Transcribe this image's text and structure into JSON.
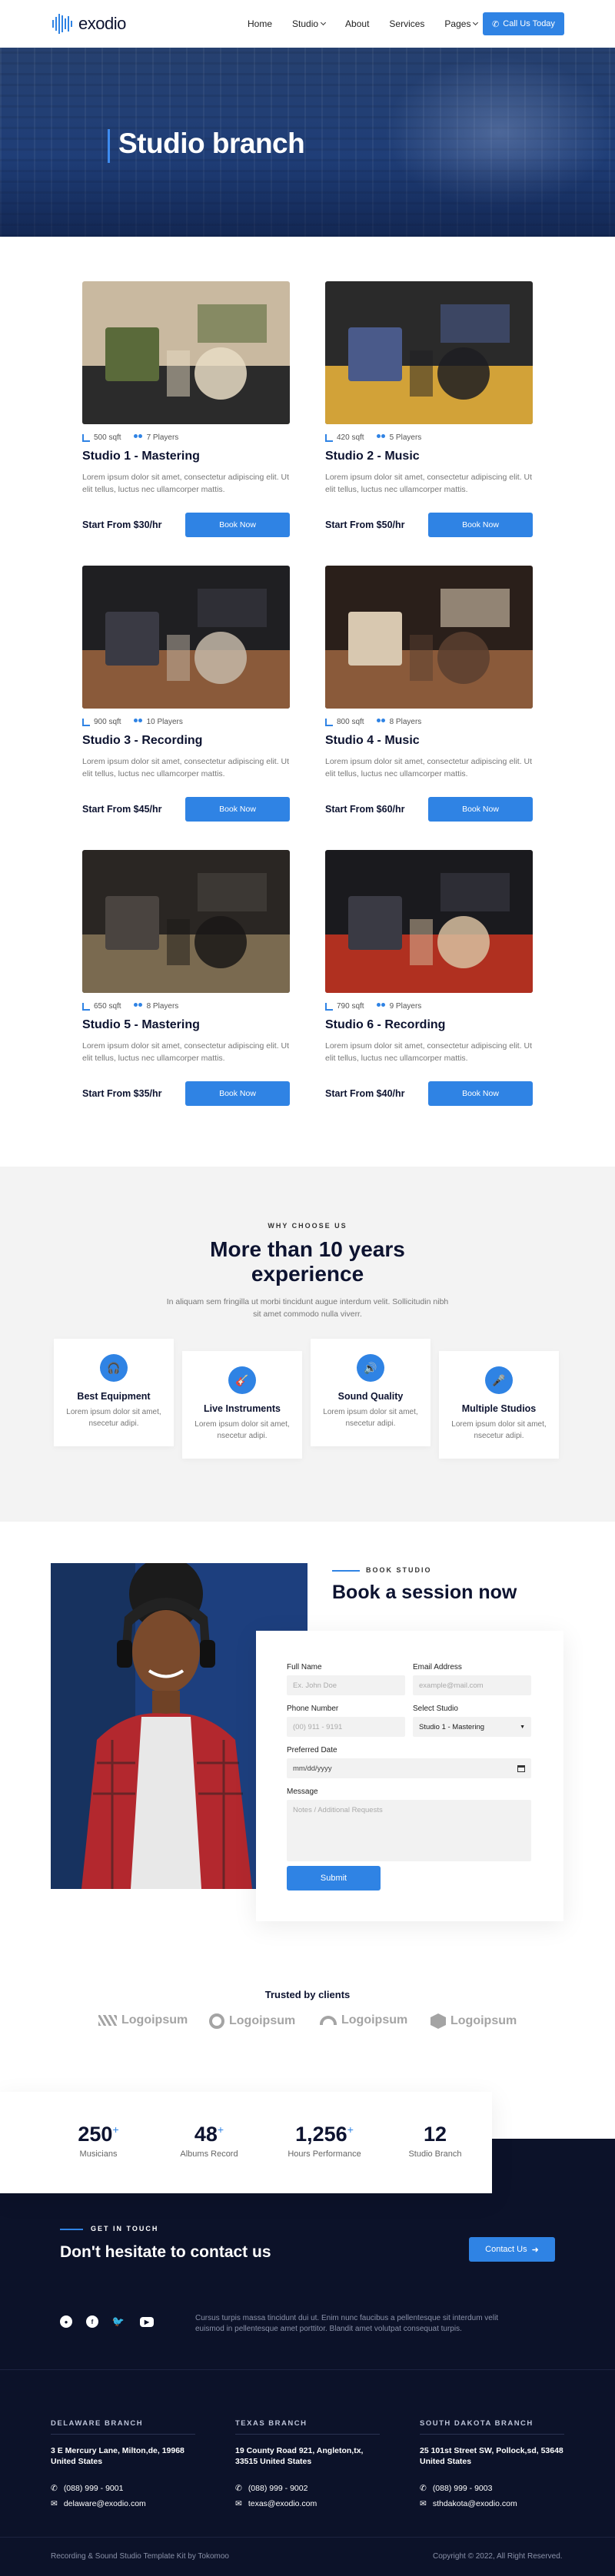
{
  "header": {
    "logo_text": "exodio",
    "nav": [
      "Home",
      "Studio",
      "About",
      "Services",
      "Pages"
    ],
    "call_label": "Call Us Today"
  },
  "hero": {
    "title": "Studio branch"
  },
  "studios": [
    {
      "size": "500 sqft",
      "players": "7 Players",
      "title": "Studio 1 - Mastering",
      "desc": "Lorem ipsum dolor sit amet, consectetur adipiscing elit. Ut elit tellus, luctus nec ullamcorper mattis.",
      "price": "Start From $30/hr",
      "cta": "Book Now"
    },
    {
      "size": "420 sqft",
      "players": "5 Players",
      "title": "Studio 2 - Music",
      "desc": "Lorem ipsum dolor sit amet, consectetur adipiscing elit. Ut elit tellus, luctus nec ullamcorper mattis.",
      "price": "Start From $50/hr",
      "cta": "Book Now"
    },
    {
      "size": "900 sqft",
      "players": "10 Players",
      "title": "Studio 3 - Recording",
      "desc": "Lorem ipsum dolor sit amet, consectetur adipiscing elit. Ut elit tellus, luctus nec ullamcorper mattis.",
      "price": "Start From $45/hr",
      "cta": "Book Now"
    },
    {
      "size": "800 sqft",
      "players": "8 Players",
      "title": "Studio 4 - Music",
      "desc": "Lorem ipsum dolor sit amet, consectetur adipiscing elit. Ut elit tellus, luctus nec ullamcorper mattis.",
      "price": "Start From $60/hr",
      "cta": "Book Now"
    },
    {
      "size": "650 sqft",
      "players": "8 Players",
      "title": "Studio 5 - Mastering",
      "desc": "Lorem ipsum dolor sit amet, consectetur adipiscing elit. Ut elit tellus, luctus nec ullamcorper mattis.",
      "price": "Start From $35/hr",
      "cta": "Book Now"
    },
    {
      "size": "790 sqft",
      "players": "9 Players",
      "title": "Studio 6 - Recording",
      "desc": "Lorem ipsum dolor sit amet, consectetur adipiscing elit. Ut elit tellus, luctus nec ullamcorper mattis.",
      "price": "Start From $40/hr",
      "cta": "Book Now"
    }
  ],
  "why": {
    "eyebrow": "WHY CHOOSE US",
    "title_line1": "More than 10 years",
    "title_line2": "experience",
    "desc_line1": "In aliquam sem fringilla ut morbi tincidunt augue interdum velit. Sollicitudin nibh",
    "desc_line2": "sit amet commodo nulla viverr.",
    "features": [
      {
        "title": "Best Equipment",
        "desc": "Lorem ipsum dolor sit amet, nsecetur adipi."
      },
      {
        "title": "Live Instruments",
        "desc": "Lorem ipsum dolor sit amet, nsecetur adipi."
      },
      {
        "title": "Sound Quality",
        "desc": "Lorem ipsum dolor sit amet, nsecetur adipi."
      },
      {
        "title": "Multiple Studios",
        "desc": "Lorem ipsum dolor sit amet, nsecetur adipi."
      }
    ]
  },
  "booking": {
    "eyebrow": "BOOK STUDIO",
    "title": "Book a session now",
    "full_name_label": "Full Name",
    "full_name_placeholder": "Ex. John Doe",
    "email_label": "Email Address",
    "email_placeholder": "example@mail.com",
    "phone_label": "Phone Number",
    "phone_placeholder": "(00) 911 - 9191",
    "select_label": "Select Studio",
    "select_value": "Studio 1 - Mastering",
    "date_label": "Preferred Date",
    "date_placeholder": "mm/dd/yyyy",
    "message_label": "Message",
    "message_placeholder": "Notes / Additional Requests",
    "submit": "Submit"
  },
  "clients": {
    "title": "Trusted by clients",
    "logos": [
      "Logoipsum",
      "Logoipsum",
      "Logoipsum",
      "Logoipsum"
    ]
  },
  "stats": [
    {
      "num": "250",
      "plus": "+",
      "label": "Musicians"
    },
    {
      "num": "48",
      "plus": "+",
      "label": "Albums Record"
    },
    {
      "num": "1,256",
      "plus": "+",
      "label": "Hours Performance"
    },
    {
      "num": "12",
      "plus": "",
      "label": "Studio Branch"
    }
  ],
  "contact": {
    "eyebrow": "GET IN TOUCH",
    "title": "Don't hesitate to contact us",
    "button": "Contact Us",
    "about_line1": "Cursus turpis massa tincidunt dui ut. Enim nunc faucibus a pellentesque sit interdum velit",
    "about_line2": "euismod in pellentesque  amet porttitor. Blandit amet volutpat consequat turpis."
  },
  "branches": [
    {
      "name": "DELAWARE BRANCH",
      "addr1": "3 E Mercury Lane, Milton,de, 19968",
      "addr2": "United States",
      "phone": "(088) 999 - 9001",
      "email": "delaware@exodio.com"
    },
    {
      "name": "TEXAS BRANCH",
      "addr1": "19 County Road 921, Angleton,tx,",
      "addr2": "33515 United States",
      "phone": "(088) 999 - 9002",
      "email": "texas@exodio.com"
    },
    {
      "name": "SOUTH DAKOTA BRANCH",
      "addr1": "25 101st Street SW, Pollock,sd, 53648",
      "addr2": "United States",
      "phone": "(088) 999 - 9003",
      "email": "sthdakota@exodio.com"
    }
  ],
  "footer": {
    "left": "Recording & Sound Studio Template Kit by Tokomoo",
    "right": "Copyright © 2022, All Right Reserved."
  },
  "colors": {
    "accent": "#2f83e4",
    "dark": "#0c1229"
  }
}
